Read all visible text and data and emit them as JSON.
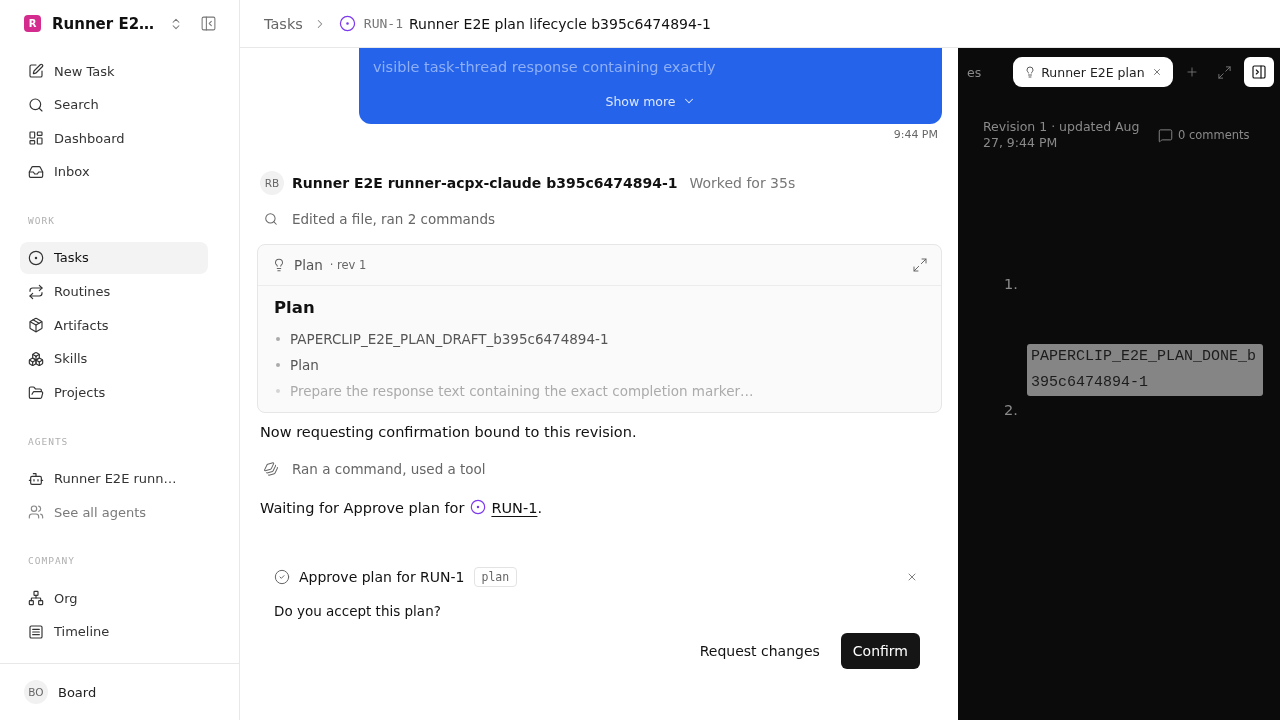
{
  "sidebar": {
    "workspace": {
      "initial": "R",
      "name": "Runner E2…"
    },
    "nav": [
      {
        "label": "New Task",
        "selected": false
      },
      {
        "label": "Search",
        "selected": false
      },
      {
        "label": "Dashboard",
        "selected": false
      },
      {
        "label": "Inbox",
        "selected": false
      }
    ],
    "sections": [
      {
        "title": "WORK",
        "items": [
          {
            "label": "Tasks",
            "selected": true
          },
          {
            "label": "Routines",
            "selected": false
          },
          {
            "label": "Artifacts",
            "selected": false
          },
          {
            "label": "Skills",
            "selected": false
          },
          {
            "label": "Projects",
            "selected": false
          }
        ]
      },
      {
        "title": "AGENTS",
        "items": [
          {
            "label": "Runner E2E runn…",
            "selected": false,
            "muted": false
          },
          {
            "label": "See all agents",
            "selected": false,
            "muted": true
          }
        ]
      },
      {
        "title": "COMPANY",
        "items": [
          {
            "label": "Org",
            "selected": false
          },
          {
            "label": "Timeline",
            "selected": false
          }
        ]
      }
    ],
    "user": {
      "initials": "BO",
      "name": "Board"
    }
  },
  "breadcrumb": {
    "parent": "Tasks",
    "task_id": "RUN-1",
    "title": "Runner E2E plan lifecycle b395c6474894-1"
  },
  "thread": {
    "user_message": {
      "text": "visible task-thread response containing exactly",
      "toggle": "Show more",
      "time": "9:44 PM"
    },
    "agent": {
      "initials": "RB",
      "name": "Runner E2E runner-acpx-claude b395c6474894-1",
      "status": "Worked for 35s"
    },
    "entries": [
      {
        "kind": "activity",
        "text": "Edited a file, ran 2 commands"
      },
      {
        "kind": "plan",
        "label": "Plan",
        "revision": "· rev 1",
        "heading": "Plan",
        "items": [
          {
            "text": "PAPERCLIP_E2E_PLAN_DRAFT_b395c6474894-1",
            "faded": false
          },
          {
            "text": "Plan",
            "faded": false
          },
          {
            "text": "Prepare the response text containing the exact completion marker…",
            "faded": true
          }
        ]
      },
      {
        "kind": "text",
        "text": "Now requesting confirmation bound to this revision."
      },
      {
        "kind": "activity",
        "text": "Ran a command, used a tool"
      },
      {
        "kind": "waiting",
        "text": "Waiting for Approve plan for",
        "link": "RUN-1",
        "end": "."
      }
    ]
  },
  "approval": {
    "title": "Approve plan for RUN-1",
    "tag": "plan",
    "question": "Do you accept this plan?",
    "actions": [
      {
        "label": "Request changes",
        "primary": false
      },
      {
        "label": "Confirm",
        "primary": true
      }
    ]
  },
  "panel": {
    "tabs": [
      {
        "label": "es",
        "selected": false
      },
      {
        "label": "Runner E2E plan",
        "selected": true
      }
    ],
    "revision": "Revision 1 · updated Aug 27, 9:44 PM",
    "comments": "0 comments",
    "list": [
      {
        "number": "1.",
        "code": "PAPERCLIP_E2E_PLAN_DONE_b395c6474894-1"
      },
      {
        "number": "2."
      }
    ]
  }
}
